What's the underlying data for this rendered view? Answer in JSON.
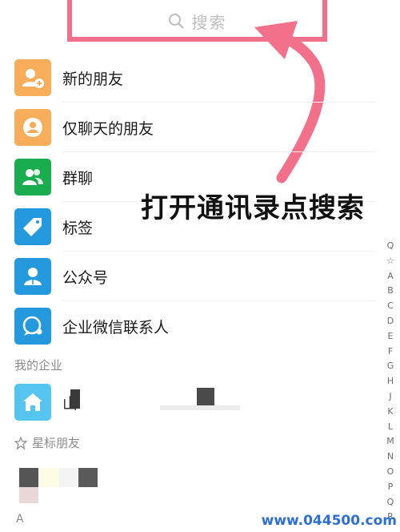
{
  "search": {
    "placeholder_label": "搜索"
  },
  "rows": [
    {
      "label": "新的朋友",
      "icon": "add-friend-icon",
      "color": "#f8ad5a"
    },
    {
      "label": "仅聊天的朋友",
      "icon": "chat-only-friend-icon",
      "color": "#f8ad5a"
    },
    {
      "label": "群聊",
      "icon": "group-chat-icon",
      "color": "#1aad4f"
    },
    {
      "label": "标签",
      "icon": "tag-icon",
      "color": "#2599de"
    },
    {
      "label": "公众号",
      "icon": "official-account-icon",
      "color": "#2599de"
    },
    {
      "label": "企业微信联系人",
      "icon": "wecom-contact-icon",
      "color": "#2599de"
    }
  ],
  "sections": {
    "my_enterprise": "我的企业",
    "enterprise_item_icon": "home-icon",
    "enterprise_item_color": "#55c4ef",
    "enterprise_item_text": "山",
    "starred_friends": "星标朋友",
    "starred_icon": "star-outline-icon",
    "letter_a": "A"
  },
  "annotation": {
    "text": "打开通讯录点搜索",
    "arrow_color": "#f2708a"
  },
  "index_bar": [
    "Q",
    "☆",
    "A",
    "B",
    "C",
    "D",
    "E",
    "F",
    "G",
    "H",
    "J",
    "K",
    "L",
    "M",
    "N",
    "O",
    "P",
    "Q",
    "R"
  ],
  "watermark": "www.044500.com"
}
